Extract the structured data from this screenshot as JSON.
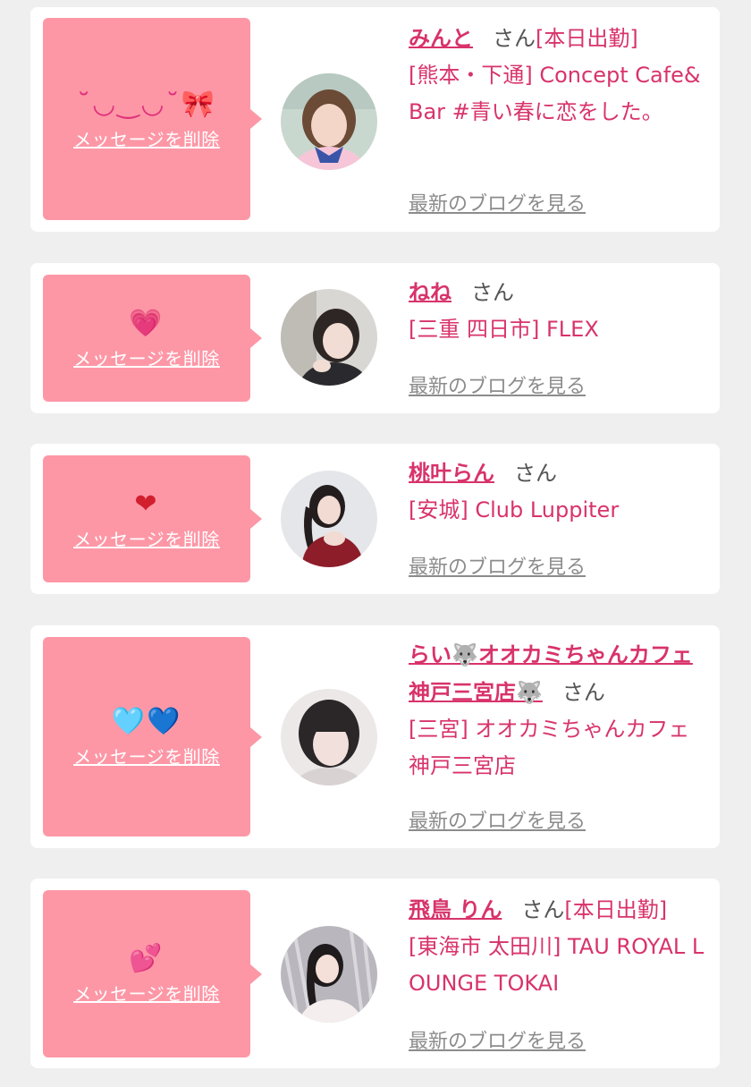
{
  "common": {
    "delete_label": "メッセージを削除",
    "honorific": "さん",
    "blog_label": "最新のブログを見る",
    "today_badge": "[本日出勤]"
  },
  "colors": {
    "page_bg": "#efefef",
    "card_bg": "#ffffff",
    "bubble_bg": "#fd97a6",
    "accent": "#d8336b",
    "muted": "#8c8c8c"
  },
  "messages": [
    {
      "stamp": "˘◡‿◡˘🎀",
      "stamp_icon": "face-ribbon-kaomoji",
      "name": "みんと",
      "today": "[本日出勤]",
      "shop": "[熊本・下通] Concept Cafe&Bar #青い春に恋をした。"
    },
    {
      "stamp": "💗",
      "stamp_icon": "growing-heart-icon",
      "name": "ねね",
      "today": "",
      "shop": "[三重 四日市] FLEX"
    },
    {
      "stamp": "❤",
      "stamp_icon": "red-heart-icon",
      "name": "桃叶らん",
      "today": "",
      "shop": "[安城] Club Luppiter"
    },
    {
      "stamp": "🩵💙",
      "stamp_icon": "light-blue-and-blue-heart-icons",
      "name": "らい🐺オオカミちゃんカフェ神戸三宮店🐺",
      "today": "",
      "shop": "[三宮] オオカミちゃんカフェ神戸三宮店"
    },
    {
      "stamp": "💕",
      "stamp_icon": "two-hearts-icon",
      "name": "飛鳥 りん",
      "today": "[本日出勤]",
      "shop": "[東海市 太田川] TAU ROYAL LOUNGE TOKAI"
    }
  ]
}
